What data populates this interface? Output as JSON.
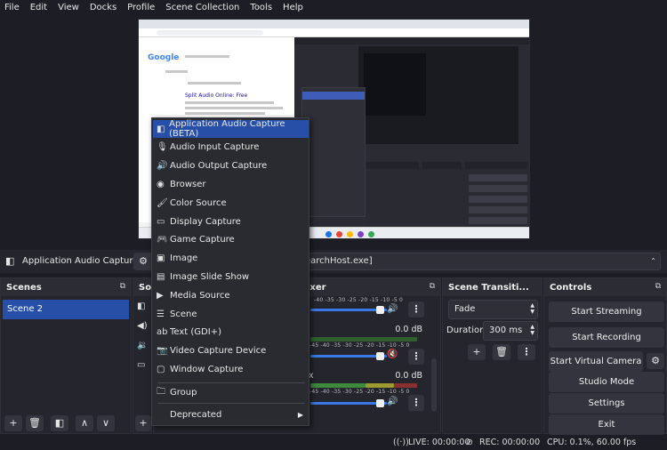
{
  "menubar": [
    "File",
    "Edit",
    "View",
    "Docks",
    "Profile",
    "Scene Collection",
    "Tools",
    "Help"
  ],
  "preview": {
    "google_logo": "Google",
    "result_link": "Split Audio Online: Free"
  },
  "context_menu": {
    "items": [
      {
        "label": "Application Audio Capture (BETA)",
        "icon": "app-audio-icon",
        "glyph": "◧",
        "active": true
      },
      {
        "label": "Audio Input Capture",
        "icon": "microphone-icon",
        "glyph": "🎙"
      },
      {
        "label": "Audio Output Capture",
        "icon": "speaker-icon",
        "glyph": "🔊"
      },
      {
        "label": "Browser",
        "icon": "globe-icon",
        "glyph": "◉"
      },
      {
        "label": "Color Source",
        "icon": "brush-icon",
        "glyph": "🖌"
      },
      {
        "label": "Display Capture",
        "icon": "monitor-icon",
        "glyph": "▭"
      },
      {
        "label": "Game Capture",
        "icon": "gamepad-icon",
        "glyph": "🎮"
      },
      {
        "label": "Image",
        "icon": "image-icon",
        "glyph": "▣"
      },
      {
        "label": "Image Slide Show",
        "icon": "slideshow-icon",
        "glyph": "▤"
      },
      {
        "label": "Media Source",
        "icon": "play-icon",
        "glyph": "▶"
      },
      {
        "label": "Scene",
        "icon": "list-icon",
        "glyph": "☰"
      },
      {
        "label": "Text (GDI+)",
        "icon": "text-icon",
        "glyph": "ab"
      },
      {
        "label": "Video Capture Device",
        "icon": "camera-icon",
        "glyph": "📷"
      },
      {
        "label": "Window Capture",
        "icon": "window-icon",
        "glyph": "▢"
      }
    ],
    "group": {
      "label": "Group",
      "icon": "folder-icon",
      "glyph": "🗀"
    },
    "deprecated": {
      "label": "Deprecated",
      "arrow": "▶"
    }
  },
  "source_bar": {
    "name": "Application Audio Capture",
    "icon_glyph": "◧",
    "gear_glyph": "⚙",
    "dropdown_value": "earchHost.exe]"
  },
  "scenes": {
    "title": "Scenes",
    "items": [
      "Scene 2"
    ],
    "float_glyph": "⧉",
    "buttons": [
      "+",
      "🗑",
      "◧",
      "∧",
      "∨"
    ]
  },
  "sources": {
    "title": "So",
    "float_glyph": "⧉",
    "rows": [
      "◧",
      "◀)",
      "🔉",
      "▭"
    ],
    "buttons": [
      "+",
      "🗑"
    ]
  },
  "mixer": {
    "title": "ixer",
    "float_glyph": "⧉",
    "scale": "-45 -40 -35 -30 -25 -20 -15 -10 -5 0",
    "scale_top": "-40 -35 -30 -25 -20 -15 -10 -5 0",
    "channels": [
      {
        "db": "",
        "muted": false,
        "level": 0.88
      },
      {
        "db": "0.0 dB",
        "muted": true,
        "level": 0.88
      },
      {
        "name": "x",
        "db": "0.0 dB",
        "muted": false,
        "level": 0.88
      }
    ],
    "vol_glyph": "🔊",
    "mute_glyph": "🔇",
    "kebab": "⋮"
  },
  "transitions": {
    "title": "Scene Transiti...",
    "float_glyph": "⧉",
    "type": "Fade",
    "duration_label": "Duration",
    "duration_value": "300 ms",
    "buttons": [
      "+",
      "🗑",
      "⋮"
    ]
  },
  "controls": {
    "title": "Controls",
    "float_glyph": "⧉",
    "start_streaming": "Start Streaming",
    "start_recording": "Start Recording",
    "start_virtual_camera": "Start Virtual Camera",
    "studio_mode": "Studio Mode",
    "settings": "Settings",
    "exit": "Exit",
    "gear_glyph": "⚙"
  },
  "status": {
    "live": "LIVE: 00:00:00",
    "rec": "REC: 00:00:00",
    "cpu": "CPU: 0.1%, 60.00 fps",
    "live_icon": "((·))",
    "rec_icon": "⊘"
  }
}
